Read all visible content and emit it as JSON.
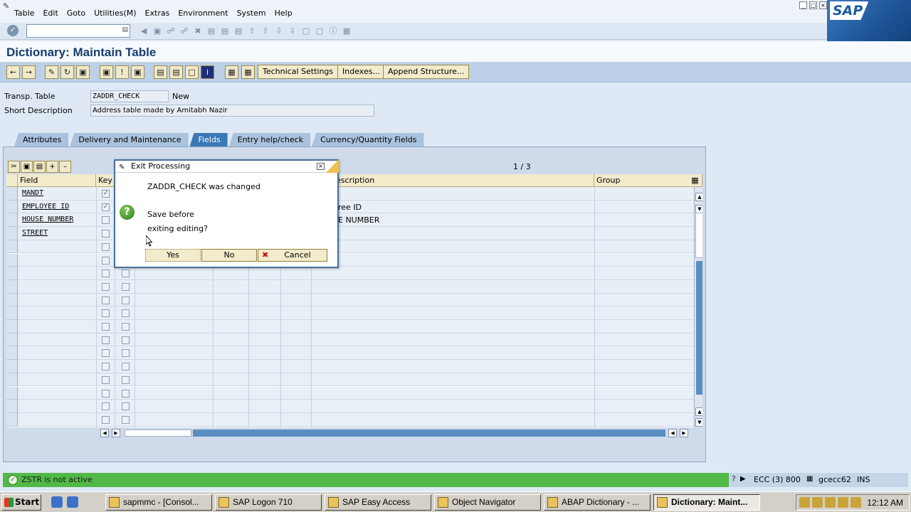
{
  "menubar": {
    "items": [
      "Table",
      "Edit",
      "Goto",
      "Utilities(M)",
      "Extras",
      "Environment",
      "System",
      "Help"
    ]
  },
  "logo": "SAP",
  "title": "Dictionary: Maintain Table",
  "app_toolbar": {
    "technical_settings": "Technical Settings",
    "indexes": "Indexes...",
    "append_structure": "Append Structure..."
  },
  "header": {
    "transp_table_label": "Transp. Table",
    "transp_table_value": "ZADDR_CHECK",
    "status": "New",
    "short_desc_label": "Short Description",
    "short_desc_value": "Address table made by Amitabh Nazir"
  },
  "tabs": [
    "Attributes",
    "Delivery and Maintenance",
    "Fields",
    "Entry help/check",
    "Currency/Quantity Fields"
  ],
  "active_tab": "Fields",
  "table": {
    "pager": "1  /  3",
    "columns": {
      "field": "Field",
      "key": "Key",
      "description": "Description",
      "group": "Group"
    },
    "description_visible_col": "escription",
    "rows": [
      {
        "field": "MANDT",
        "key": true,
        "desc": ""
      },
      {
        "field": "EMPLOYEE ID",
        "key": true,
        "desc": "ree ID"
      },
      {
        "field": "HOUSE NUMBER",
        "key": false,
        "desc": "E NUMBER"
      },
      {
        "field": "STREET",
        "key": false,
        "desc": ""
      }
    ]
  },
  "dialog": {
    "title": "Exit Processing",
    "line1": "ZADDR_CHECK was changed",
    "line2": "Save before",
    "line3": "exiting editing?",
    "yes": "Yes",
    "no": "No",
    "cancel": "Cancel"
  },
  "statusbar": {
    "message": "ZSTR is not active",
    "system": "ECC (3) 800",
    "server": "gcecc62",
    "mode": "INS"
  },
  "taskbar": {
    "start": "Start",
    "tasks": [
      "sapmmc - [Consol...",
      "SAP Logon 710",
      "SAP Easy Access",
      "Object Navigator",
      "ABAP Dictionary - ...",
      "Dictionary: Maint..."
    ],
    "clock": "12:12 AM"
  }
}
